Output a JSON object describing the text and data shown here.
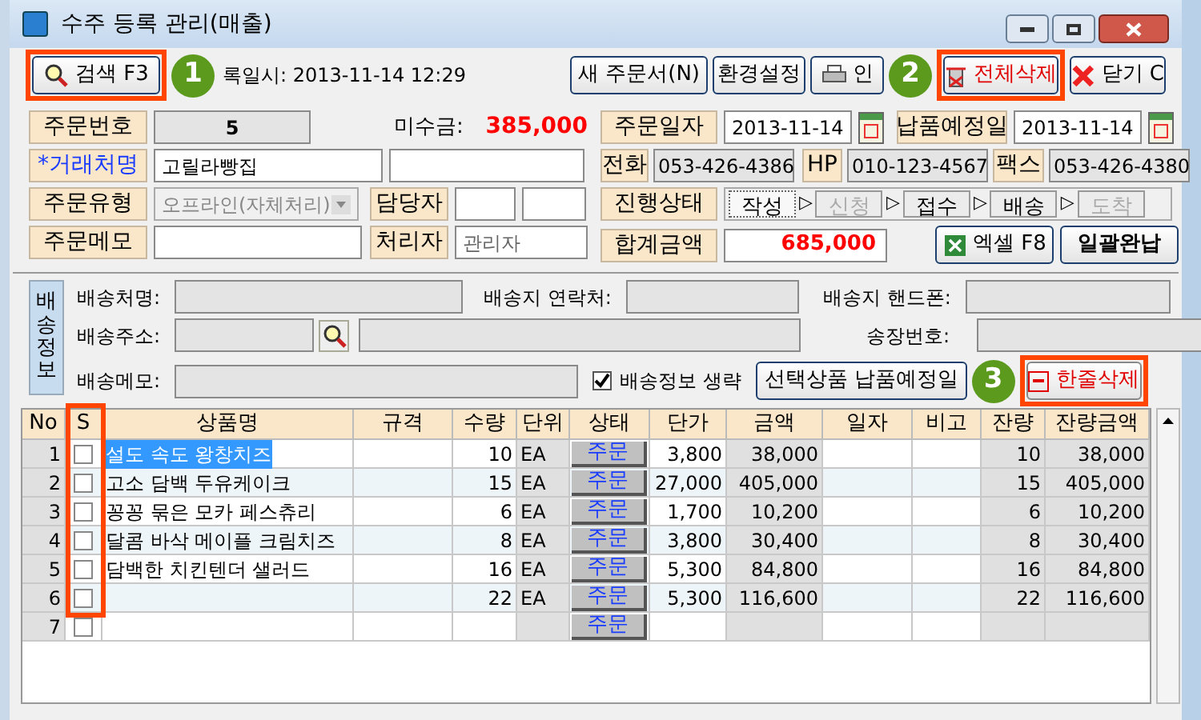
{
  "window": {
    "title": "수주 등록 관리(매출)"
  },
  "toolbar": {
    "search_button": "검색 F3",
    "registered": "록일시: 2013-11-14 12:29",
    "buttons": [
      {
        "kind": "text",
        "label": "새 주문서(N)"
      },
      {
        "kind": "text",
        "label": "환경설정"
      },
      {
        "kind": "print",
        "label": "인"
      },
      {
        "kind": "delete_all",
        "label": "전체삭제"
      },
      {
        "kind": "close",
        "label": "닫기 C"
      }
    ]
  },
  "order": {
    "number_label": "주문번호",
    "number": "5",
    "unpaid_label": "미수금:",
    "unpaid": "385,000",
    "client_label": "*거래처명",
    "client": "고릴라빵집",
    "type_label": "주문유형",
    "type": "오프라인(자체처리)",
    "manager_label": "담당자",
    "memo_label": "주문메모",
    "handler_label": "처리자",
    "handler": "관리자",
    "date_label": "주문일자",
    "date": "2013-11-14",
    "due_label": "납품예정일",
    "due": "2013-11-14",
    "phone_label": "전화",
    "phone": "053-426-4386",
    "hp_label": "HP",
    "hp": "010-123-4567",
    "fax_label": "팩스",
    "fax": "053-426-4380",
    "status_label": "진행상태",
    "steps": [
      {
        "label": "작성",
        "selected": true,
        "disabled": false
      },
      {
        "label": "신청",
        "selected": false,
        "disabled": true
      },
      {
        "label": "접수",
        "selected": false,
        "disabled": false
      },
      {
        "label": "배송",
        "selected": false,
        "disabled": false
      },
      {
        "label": "도착",
        "selected": false,
        "disabled": true
      }
    ],
    "step_arrow": "▷",
    "total_label": "합계금액",
    "total": "685,000",
    "excel_button": "엑셀 F8",
    "complete_button": "일괄완납"
  },
  "shipping": {
    "tab": "배송정보",
    "name_label": "배송처명:",
    "contact_label": "배송지 연락처:",
    "mobile_label": "배송지 핸드폰:",
    "address_label": "배송주소:",
    "invoice_label": "송장번호:",
    "memo_label": "배송메모:",
    "skip": {
      "label": "배송정보 생략",
      "checked": true
    },
    "due_button": "선택상품 납품예정일",
    "delete_row_button": "한줄삭제"
  },
  "table": {
    "columns": [
      "No",
      "S",
      "상품명",
      "규격",
      "수량",
      "단위",
      "상태",
      "단가",
      "금액",
      "일자",
      "비고",
      "잔량",
      "잔량금액"
    ],
    "rows": [
      {
        "no": "1",
        "checked": false,
        "selected": true,
        "name": "설도 속도 왕창치즈",
        "qty": "10",
        "unit": "EA",
        "status": "주문",
        "price": "3,800",
        "amount": "38,000",
        "remain": "10",
        "remain_amount": "38,000"
      },
      {
        "no": "2",
        "checked": false,
        "selected": false,
        "name": "고소 담백 두유케이크",
        "qty": "15",
        "unit": "EA",
        "status": "주문",
        "price": "27,000",
        "amount": "405,000",
        "remain": "15",
        "remain_amount": "405,000"
      },
      {
        "no": "3",
        "checked": false,
        "selected": false,
        "name": "꽁꽁 묶은 모카 페스츄리",
        "qty": "6",
        "unit": "EA",
        "status": "주문",
        "price": "1,700",
        "amount": "10,200",
        "remain": "6",
        "remain_amount": "10,200"
      },
      {
        "no": "4",
        "checked": false,
        "selected": false,
        "name": "달콤 바삭 메이플 크림치즈",
        "qty": "8",
        "unit": "EA",
        "status": "주문",
        "price": "3,800",
        "amount": "30,400",
        "remain": "8",
        "remain_amount": "30,400"
      },
      {
        "no": "5",
        "checked": false,
        "selected": false,
        "name": "담백한 치킨텐더 샐러드",
        "qty": "16",
        "unit": "EA",
        "status": "주문",
        "price": "5,300",
        "amount": "84,800",
        "remain": "16",
        "remain_amount": "84,800"
      },
      {
        "no": "6",
        "checked": false,
        "selected": false,
        "qty": "22",
        "unit": "EA",
        "status": "주문",
        "price": "5,300",
        "amount": "116,600",
        "remain": "22",
        "remain_amount": "116,600"
      },
      {
        "no": "7",
        "checked": false,
        "selected": false,
        "status": "주문"
      }
    ]
  },
  "annotations": [
    {
      "number": "1"
    },
    {
      "number": "2"
    },
    {
      "number": "3"
    }
  ]
}
